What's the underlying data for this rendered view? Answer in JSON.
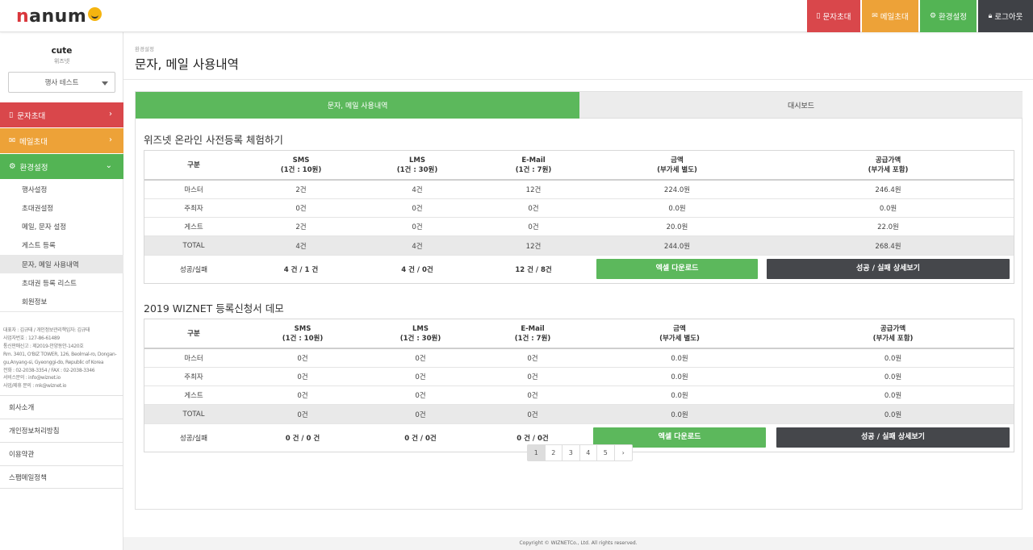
{
  "header": {
    "logo_text_n": "n",
    "logo_text_rest": "anum",
    "buttons": {
      "sms_invite": "문자초대",
      "email_invite": "메일초대",
      "settings": "환경설정",
      "logout": "로그아웃"
    }
  },
  "sidebar": {
    "user_name": "cute",
    "user_org": "위즈넷",
    "event_select": "행사 테스트",
    "nav": {
      "sms": "문자초대",
      "email": "메일초대",
      "settings": "환경설정"
    },
    "sub_items": [
      "행사설정",
      "초대권설정",
      "메일, 문자 설정",
      "게스트 등록",
      "문자, 메일 사용내역",
      "초대권 등록 리스트",
      "회원정보"
    ],
    "company_info": [
      "대표자 : 김규태 / 개인정보관리책임자: 김규태",
      "사업자번호 : 127-86-61489",
      "통신판매신고 : 제2019-안양동안-1420호",
      "Rm. 3401, O'BIZ TOWER, 126, Beolmal-ro, Dongan-",
      "gu,Anyang-si, Gyeonggi-do, Republic of Korea",
      "전화 : 02-2038-3354 / FAX : 02-2038-3346",
      "서비스문의 : info@wiznet.io",
      "사업/제휴 문의 : mk@wiznet.io"
    ],
    "footer_links": [
      "회사소개",
      "개인정보처리방침",
      "이용약관",
      "스팸메일정책"
    ]
  },
  "main": {
    "breadcrumb": "환경설정",
    "page_title": "문자, 메일 사용내역",
    "tabs": {
      "usage": "문자, 메일 사용내역",
      "dashboard": "대시보드"
    },
    "table_headers": {
      "category": "구분",
      "sms": "SMS",
      "sms_rate": "(1건 : 10원)",
      "lms": "LMS",
      "lms_rate": "(1건 : 30원)",
      "email": "E-Mail",
      "email_rate": "(1건 : 7원)",
      "amount": "금액",
      "amount_note": "(부가세 별도)",
      "supply": "공급가액",
      "supply_note": "(부가세 포함)"
    },
    "excel_label": "엑셀 다운로드",
    "detail_label": "성공 / 실패 상세보기",
    "sections": [
      {
        "title": "위즈넷 온라인 사전등록 체험하기",
        "rows": [
          {
            "label": "마스터",
            "sms": "2건",
            "lms": "4건",
            "email": "12건",
            "amount": "224.0원",
            "supply": "246.4원"
          },
          {
            "label": "주최자",
            "sms": "0건",
            "lms": "0건",
            "email": "0건",
            "amount": "0.0원",
            "supply": "0.0원"
          },
          {
            "label": "게스트",
            "sms": "2건",
            "lms": "0건",
            "email": "0건",
            "amount": "20.0원",
            "supply": "22.0원"
          },
          {
            "label": "TOTAL",
            "sms": "4건",
            "lms": "4건",
            "email": "12건",
            "amount": "244.0원",
            "supply": "268.4원"
          }
        ],
        "result": {
          "label": "성공/실패",
          "sms": "4 건 / 1 건",
          "lms": "4 건 / 0건",
          "email": "12 건 / 8건"
        }
      },
      {
        "title": "2019 WIZNET 등록신청서 데모",
        "rows": [
          {
            "label": "마스터",
            "sms": "0건",
            "lms": "0건",
            "email": "0건",
            "amount": "0.0원",
            "supply": "0.0원"
          },
          {
            "label": "주최자",
            "sms": "0건",
            "lms": "0건",
            "email": "0건",
            "amount": "0.0원",
            "supply": "0.0원"
          },
          {
            "label": "게스트",
            "sms": "0건",
            "lms": "0건",
            "email": "0건",
            "amount": "0.0원",
            "supply": "0.0원"
          },
          {
            "label": "TOTAL",
            "sms": "0건",
            "lms": "0건",
            "email": "0건",
            "amount": "0.0원",
            "supply": "0.0원"
          }
        ],
        "result": {
          "label": "성공/실패",
          "sms": "0 건 / 0 건",
          "lms": "0 건 / 0건",
          "email": "0 건 / 0건"
        }
      }
    ],
    "pagination": [
      "1",
      "2",
      "3",
      "4",
      "5",
      "›"
    ],
    "current_page": "1"
  },
  "footer": {
    "copyright": "Copyright © WIZNETCo., Ltd. All rights reserved."
  },
  "colors": {
    "red": "#d9474b",
    "orange": "#eda238",
    "green": "#53b454",
    "dark": "#3f4146"
  }
}
